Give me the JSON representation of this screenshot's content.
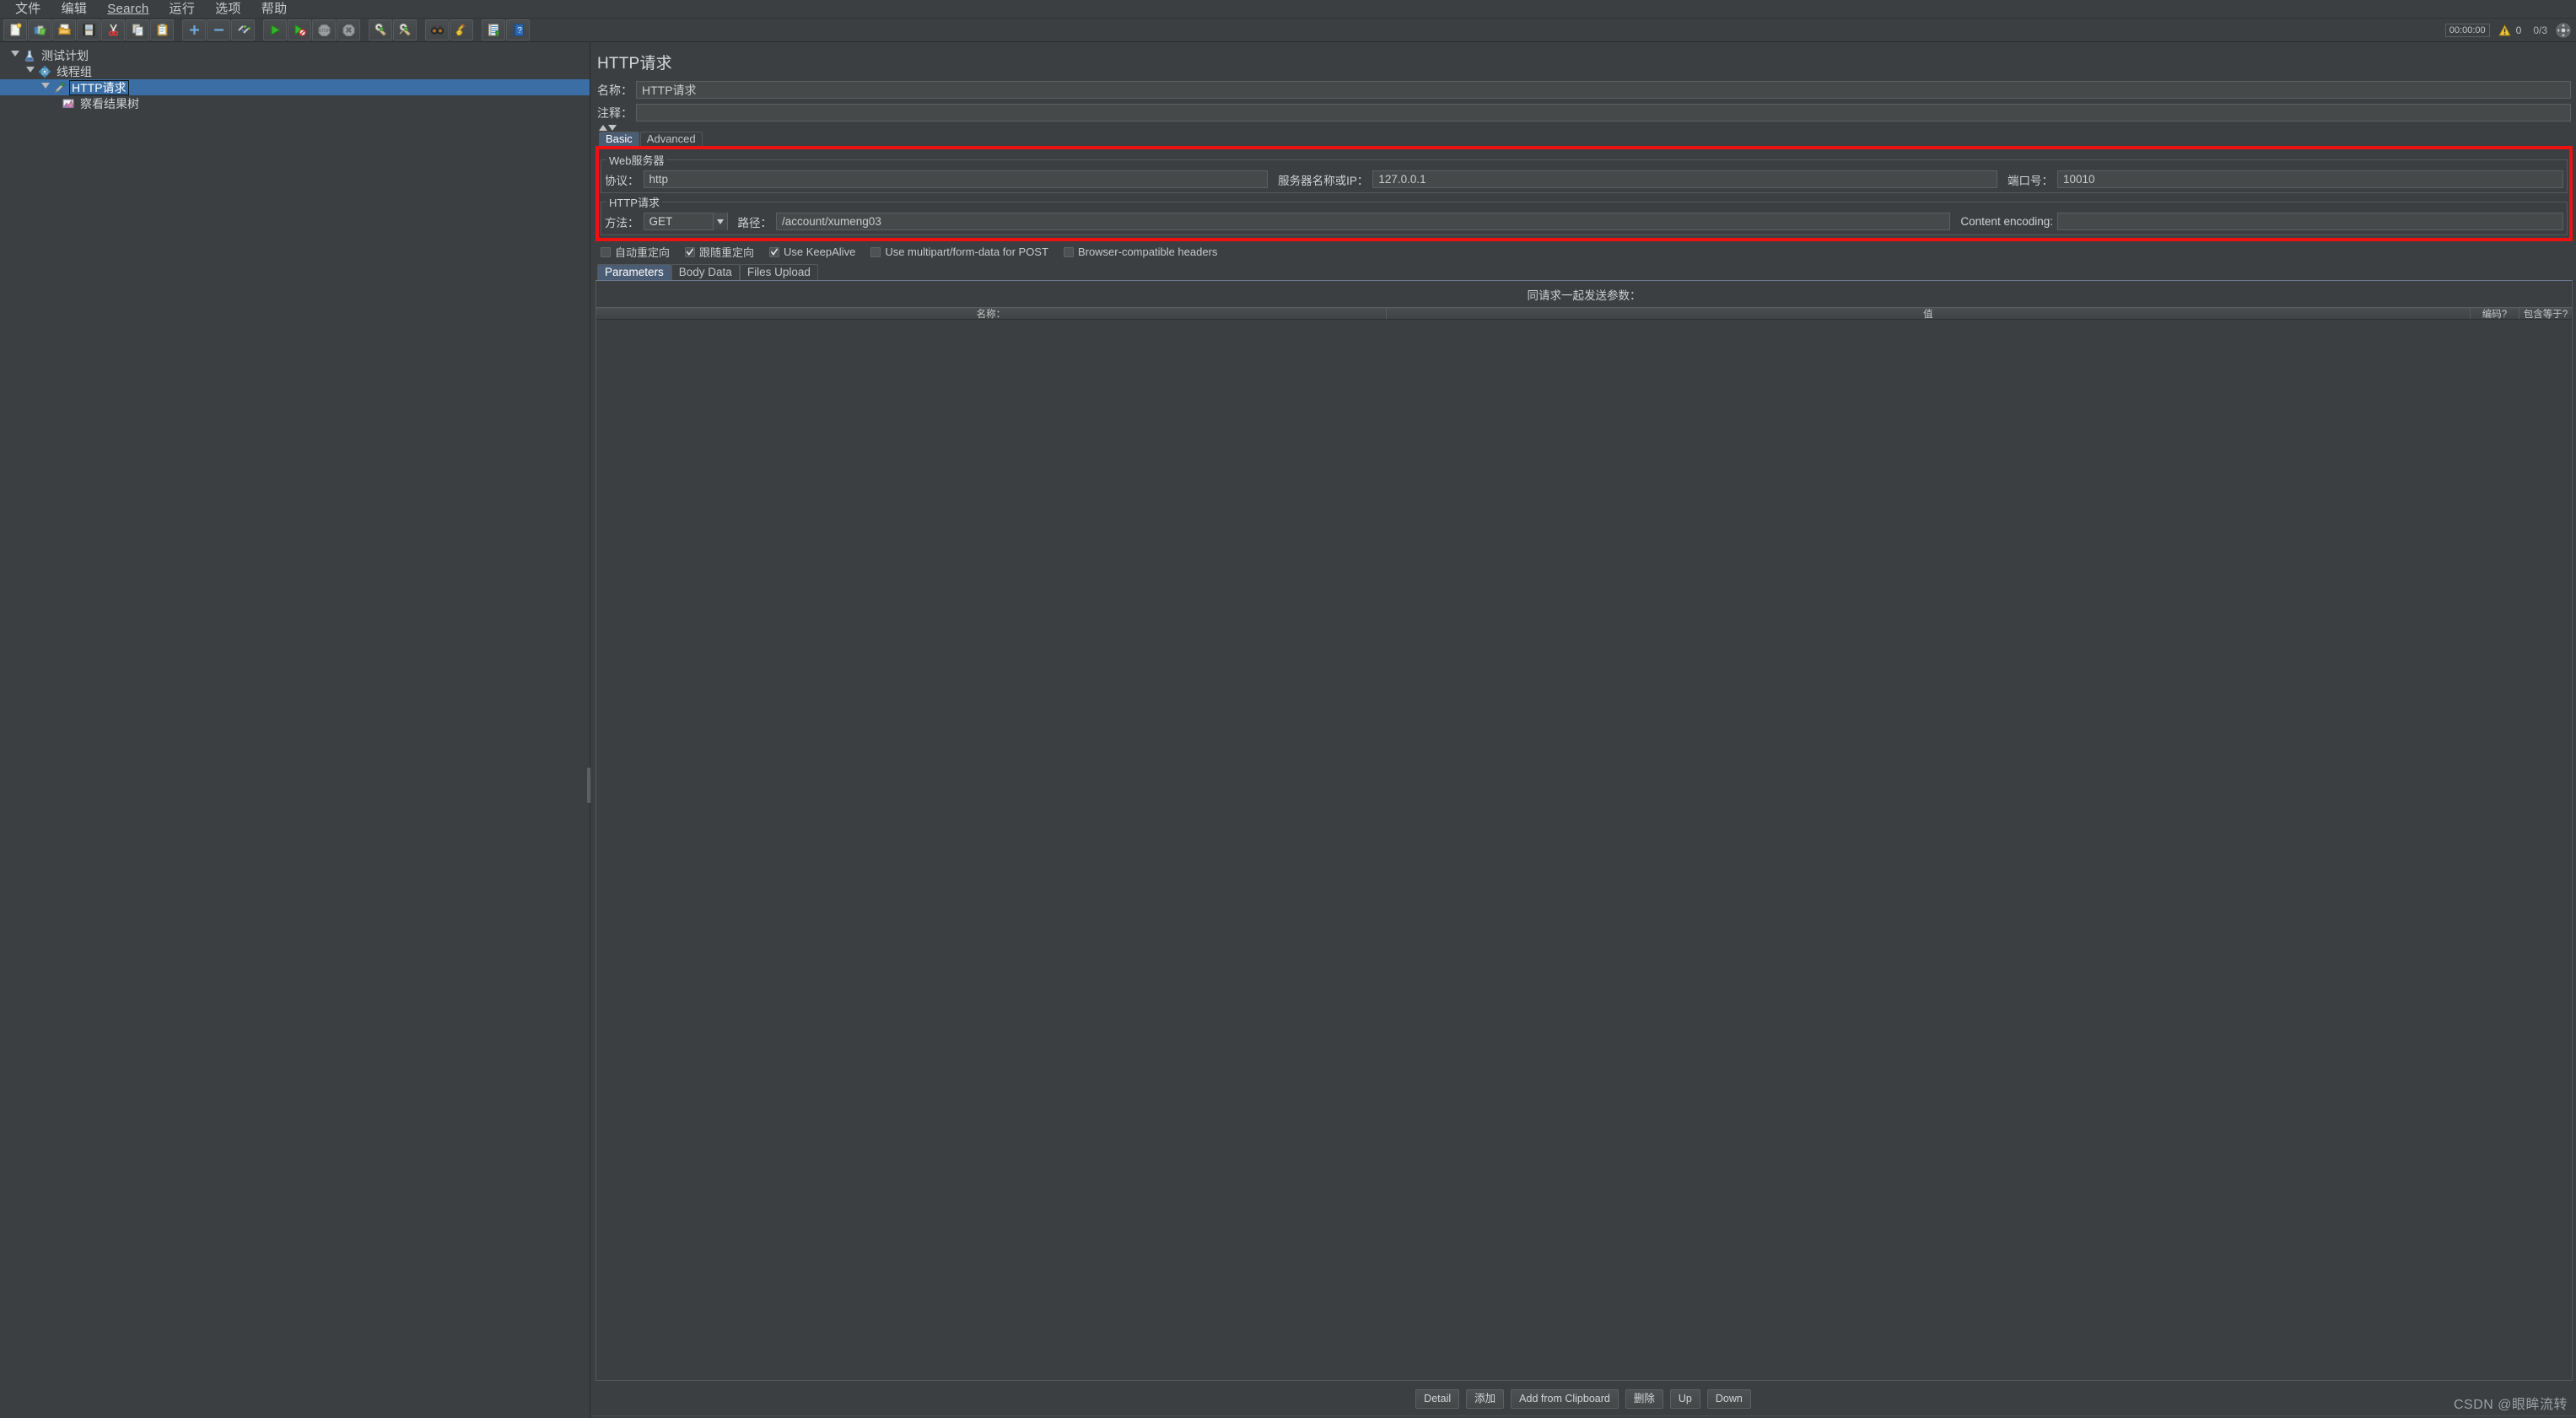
{
  "menubar": {
    "items": [
      {
        "label": "文件",
        "underlined": false
      },
      {
        "label": "编辑",
        "underlined": false
      },
      {
        "label": "Search",
        "underlined": true
      },
      {
        "label": "运行",
        "underlined": false
      },
      {
        "label": "选项",
        "underlined": false
      },
      {
        "label": "帮助",
        "underlined": false
      }
    ]
  },
  "toolbar": {
    "buttons": [
      {
        "name": "new-test-plan-icon",
        "title": "新建"
      },
      {
        "name": "templates-icon",
        "title": "模板"
      },
      {
        "name": "open-icon",
        "title": "打开"
      },
      {
        "name": "save-icon",
        "title": "保存"
      },
      {
        "name": "cut-icon",
        "title": "剪切"
      },
      {
        "name": "copy-icon",
        "title": "复制"
      },
      {
        "name": "paste-icon",
        "title": "粘贴"
      },
      {
        "name": "expand-all-icon",
        "title": "展开全部"
      },
      {
        "name": "collapse-all-icon",
        "title": "收起全部"
      },
      {
        "name": "toggle-icon",
        "title": "启用/禁用"
      },
      {
        "name": "start-icon",
        "title": "启动"
      },
      {
        "name": "start-no-pauses-icon",
        "title": "无간隔启动"
      },
      {
        "name": "stop-icon",
        "title": "停止"
      },
      {
        "name": "shutdown-icon",
        "title": "关闭"
      },
      {
        "name": "clear-icon",
        "title": "清除"
      },
      {
        "name": "clear-all-icon",
        "title": "清除全部"
      },
      {
        "name": "search-icon",
        "title": "搜索"
      },
      {
        "name": "reset-search-icon",
        "title": "重置搜索"
      },
      {
        "name": "function-helper-icon",
        "title": "函数助手"
      },
      {
        "name": "help-icon",
        "title": "帮助"
      }
    ],
    "status": {
      "timer": "00:00:00",
      "warning_count": "0",
      "threads_ratio": "0/3",
      "connection_icon": "connection-icon"
    }
  },
  "tree": {
    "items": [
      {
        "label": "测试计划",
        "icon": "test-plan-icon",
        "depth": 0,
        "expanded": true,
        "selected": false
      },
      {
        "label": "线程组",
        "icon": "thread-group-icon",
        "depth": 1,
        "expanded": true,
        "selected": false
      },
      {
        "label": "HTTP请求",
        "icon": "http-request-icon",
        "depth": 2,
        "expanded": true,
        "selected": true
      },
      {
        "label": "察看结果树",
        "icon": "view-results-tree-icon",
        "depth": 3,
        "expanded": false,
        "selected": false
      }
    ]
  },
  "main": {
    "title": "HTTP请求",
    "name_label": "名称：",
    "name_value": "HTTP请求",
    "comment_label": "注释：",
    "comment_value": "",
    "tabs": [
      {
        "label": "Basic",
        "active": true
      },
      {
        "label": "Advanced",
        "active": false
      }
    ],
    "web_server": {
      "legend": "Web服务器",
      "protocol_label": "协议：",
      "protocol_value": "http",
      "server_label": "服务器名称或IP：",
      "server_value": "127.0.0.1",
      "port_label": "端口号：",
      "port_value": "10010"
    },
    "http_request": {
      "legend": "HTTP请求",
      "method_label": "方法：",
      "method_value": "GET",
      "path_label": "路径：",
      "path_value": "/account/xumeng03",
      "encoding_label": "Content encoding:",
      "encoding_value": ""
    },
    "checkboxes": [
      {
        "label": "自动重定向",
        "checked": false
      },
      {
        "label": "跟随重定向",
        "checked": true
      },
      {
        "label": "Use KeepAlive",
        "checked": true
      },
      {
        "label": "Use multipart/form-data for POST",
        "checked": false
      },
      {
        "label": "Browser-compatible headers",
        "checked": false
      }
    ],
    "param_tabs": [
      {
        "label": "Parameters",
        "active": true
      },
      {
        "label": "Body Data",
        "active": false
      },
      {
        "label": "Files Upload",
        "active": false
      }
    ],
    "params_caption": "同请求一起发送参数：",
    "params_columns": [
      "名称：",
      "值",
      "编码?",
      "包含等于?"
    ],
    "params_rows": [],
    "buttons": [
      {
        "label": "Detail"
      },
      {
        "label": "添加"
      },
      {
        "label": "Add from Clipboard"
      },
      {
        "label": "删除"
      },
      {
        "label": "Up"
      },
      {
        "label": "Down"
      }
    ]
  },
  "watermark": "CSDN @眼眸流转",
  "colors": {
    "accent": "#3a6ea5",
    "highlight_border": "#ee1111",
    "tab_active": "#4b5c75",
    "background": "#3c3f41"
  }
}
